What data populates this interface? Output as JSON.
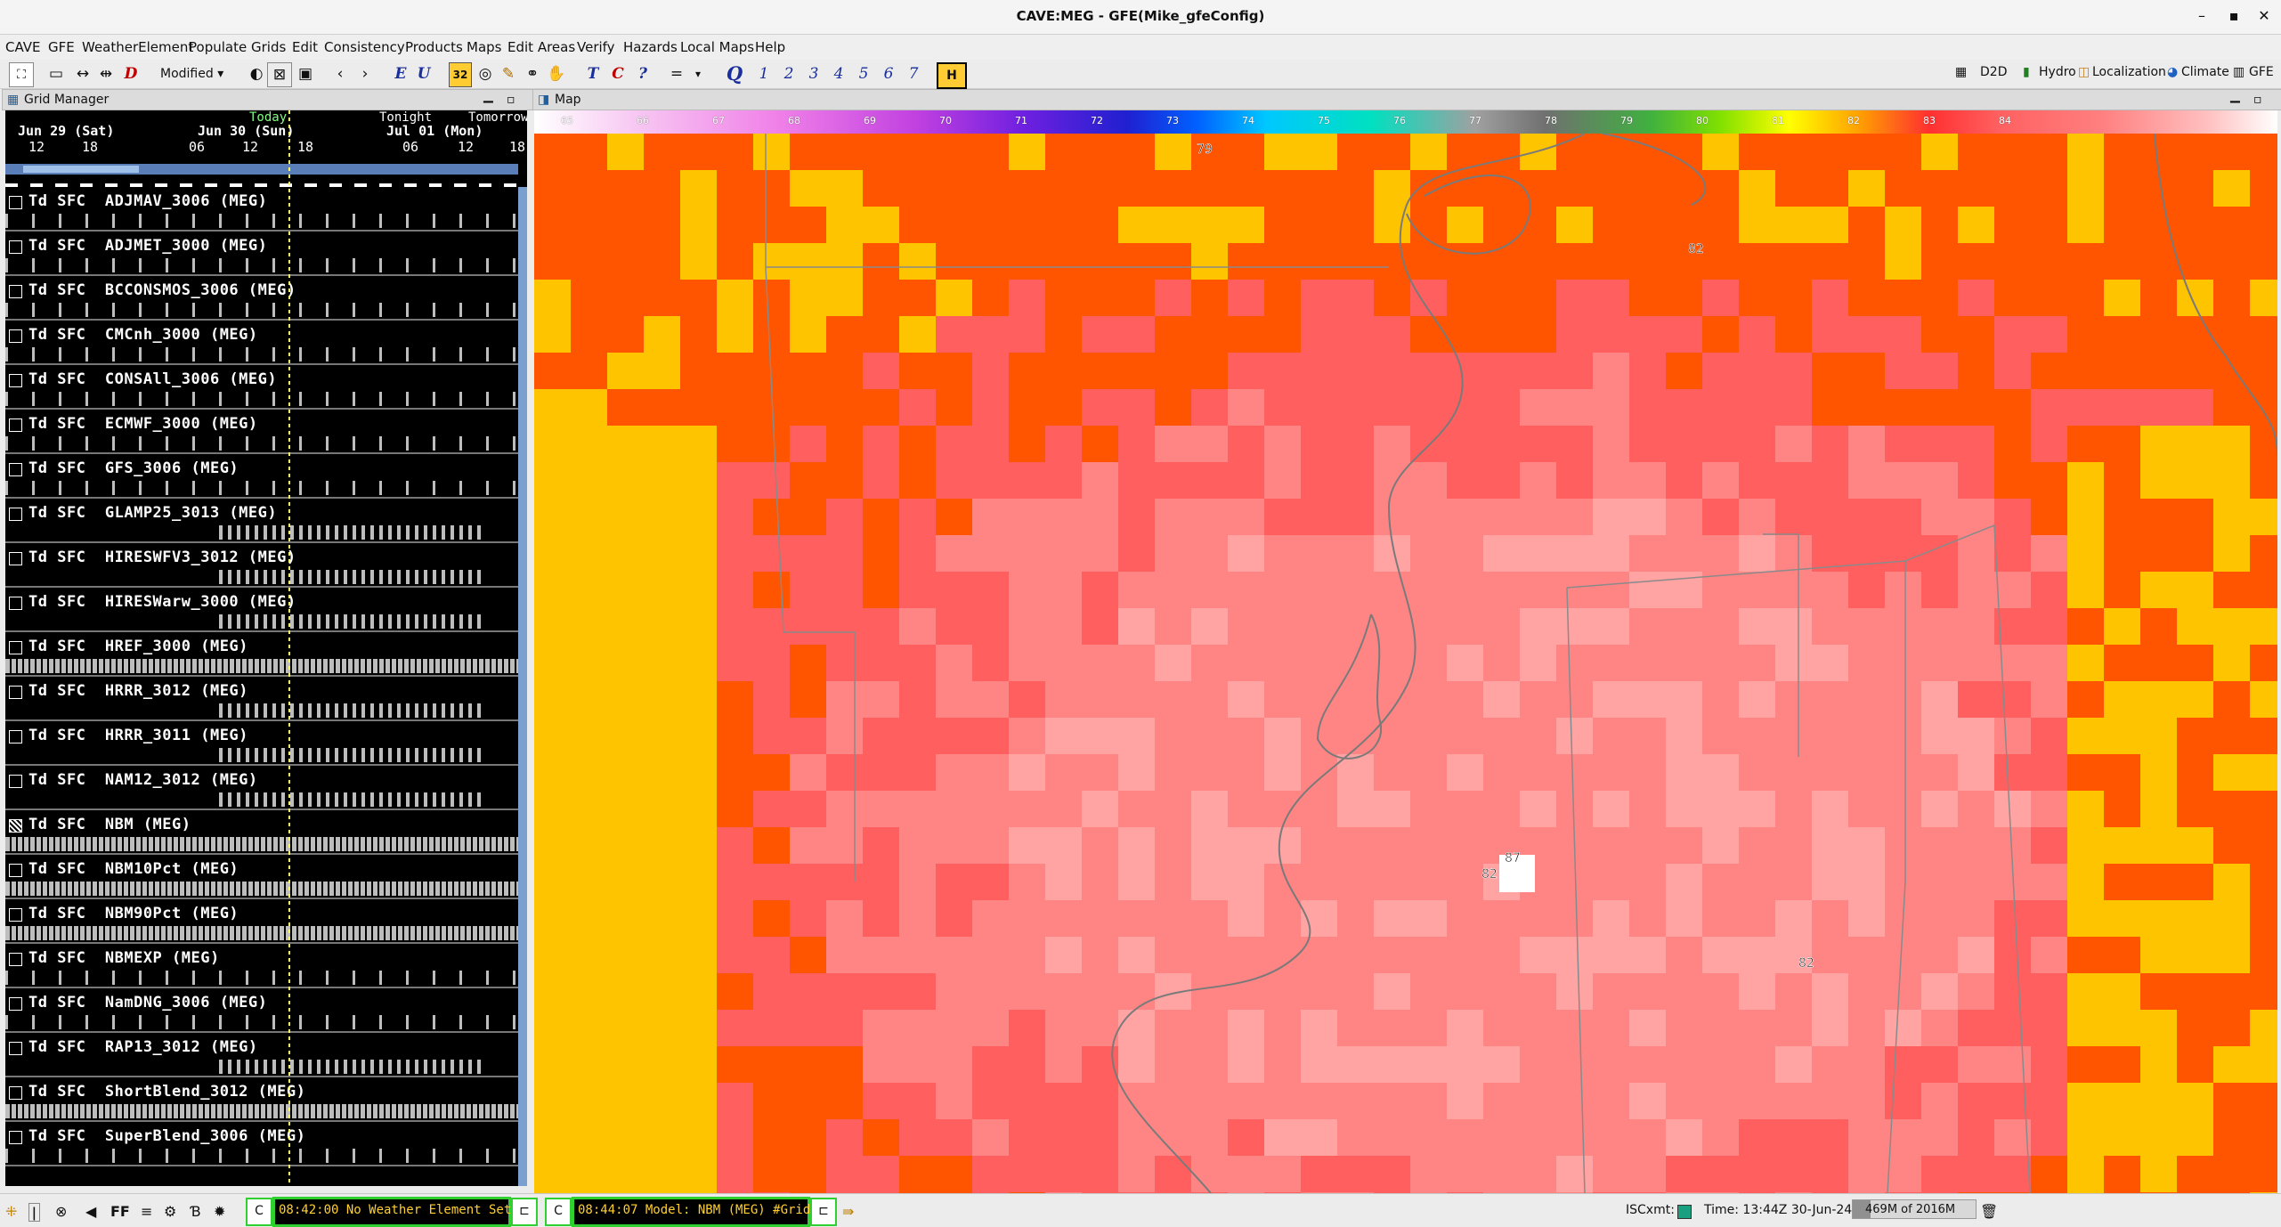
{
  "window": {
    "title": "CAVE:MEG - GFE(Mike_gfeConfig)",
    "minimize": "–",
    "maximize": "▪",
    "close": "✕"
  },
  "menu": [
    "CAVE",
    "GFE",
    "WeatherElement",
    "Populate",
    "Grids",
    "Edit",
    "Consistency",
    "Products",
    "Maps",
    "Edit Areas",
    "Verify",
    "Hazards",
    "Local Maps",
    "Help"
  ],
  "toolbar": {
    "edit_state": "Modified",
    "eu_e": "E",
    "eu_u": "U",
    "badge": "32",
    "tool_t": "T",
    "tool_c": "C",
    "tool_q": "?",
    "equals": "=",
    "q_label": "Q",
    "numbers": [
      "1",
      "2",
      "3",
      "4",
      "5",
      "6",
      "7"
    ]
  },
  "perspectives": {
    "d2d": "D2D",
    "hydro": "Hydro",
    "localization": "Localization",
    "climate": "Climate",
    "gfe": "GFE"
  },
  "grid_manager": {
    "tab_label": "Grid Manager",
    "timeline": {
      "markers": [
        "Today",
        "Tonight",
        "Tomorrow"
      ],
      "days": [
        "Jun 29 (Sat)",
        "Jun 30 (Sun)",
        "Jul 01 (Mon)"
      ],
      "hours": [
        "12",
        "18",
        "06",
        "12",
        "18",
        "06",
        "12",
        "18"
      ]
    },
    "rows": [
      {
        "name": "Td SFC  ADJMAV_3006 (MEG)",
        "style": "sparse"
      },
      {
        "name": "Td SFC  ADJMET_3000 (MEG)",
        "style": "sparse"
      },
      {
        "name": "Td SFC  BCCONSMOS_3006 (MEG)",
        "style": "sparse"
      },
      {
        "name": "Td SFC  CMCnh_3000 (MEG)",
        "style": "sparse"
      },
      {
        "name": "Td SFC  CONSAll_3006 (MEG)",
        "style": "sparse"
      },
      {
        "name": "Td SFC  ECMWF_3000 (MEG)",
        "style": "sparse"
      },
      {
        "name": "Td SFC  GFS_3006 (MEG)",
        "style": "sparse"
      },
      {
        "name": "Td SFC  GLAMP25_3013 (MEG)",
        "style": "partial"
      },
      {
        "name": "Td SFC  HIRESWFV3_3012 (MEG)",
        "style": "partial"
      },
      {
        "name": "Td SFC  HIRESWarw_3000 (MEG)",
        "style": "partial"
      },
      {
        "name": "Td SFC  HREF_3000 (MEG)",
        "style": "dense"
      },
      {
        "name": "Td SFC  HRRR_3012 (MEG)",
        "style": "partial"
      },
      {
        "name": "Td SFC  HRRR_3011 (MEG)",
        "style": "partial"
      },
      {
        "name": "Td SFC  NAM12_3012 (MEG)",
        "style": "partial"
      },
      {
        "name": "Td SFC  NBM (MEG)",
        "style": "dense",
        "selected": true
      },
      {
        "name": "Td SFC  NBM10Pct (MEG)",
        "style": "dense"
      },
      {
        "name": "Td SFC  NBM90Pct (MEG)",
        "style": "dense"
      },
      {
        "name": "Td SFC  NBMEXP (MEG)",
        "style": "sparse"
      },
      {
        "name": "Td SFC  NamDNG_3006 (MEG)",
        "style": "sparse"
      },
      {
        "name": "Td SFC  RAP13_3012 (MEG)",
        "style": "partial"
      },
      {
        "name": "Td SFC  ShortBlend_3012 (MEG)",
        "style": "dense"
      },
      {
        "name": "Td SFC  SuperBlend_3006 (MEG)",
        "style": "sparse"
      }
    ]
  },
  "map": {
    "tab_label": "Map",
    "colorbar_ticks": [
      "65",
      "66",
      "67",
      "68",
      "69",
      "70",
      "71",
      "72",
      "73",
      "74",
      "75",
      "76",
      "77",
      "78",
      "79",
      "80",
      "81",
      "82",
      "83",
      "84"
    ],
    "sample_labels": [
      "79",
      "82",
      "82",
      "87",
      "82"
    ],
    "colors": {
      "gold": "#ffc400",
      "orange": "#ff5400",
      "red": "#ff5f5f",
      "pink": "#ff8585",
      "lightpink": "#ffa3a3",
      "white": "#ffffff"
    }
  },
  "status": {
    "c1": "C",
    "msg1": "08:42:00 No Weather Element Set",
    "c2": "C",
    "msg2": "08:44:07 Model: NBM (MEG) #Grid",
    "iscxmt": "ISCxmt:",
    "time": "Time: 13:44Z 30-Jun-24",
    "memory": "469M of 2016M"
  }
}
